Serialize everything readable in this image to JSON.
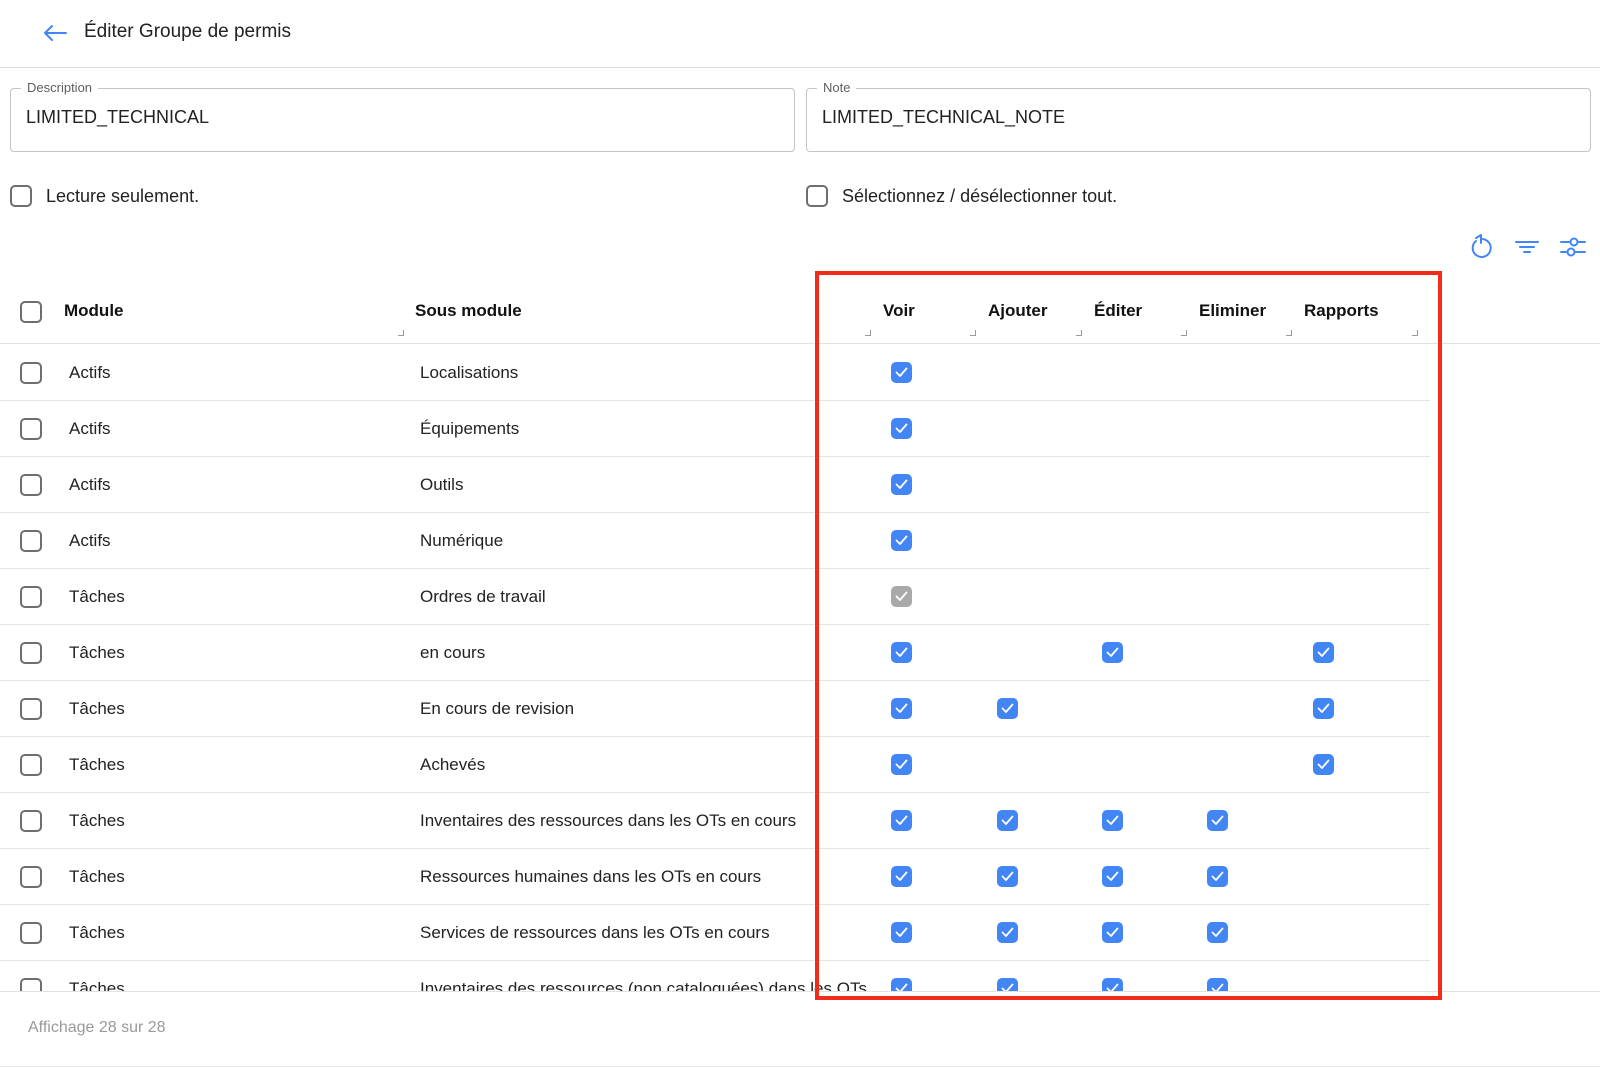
{
  "header": {
    "title": "Éditer Groupe de permis"
  },
  "form": {
    "description": {
      "label": "Description",
      "value": "LIMITED_TECHNICAL"
    },
    "note": {
      "label": "Note",
      "value": "LIMITED_TECHNICAL_NOTE"
    },
    "read_only_label": "Lecture seulement.",
    "select_all_label": "Sélectionnez / désélectionner tout."
  },
  "toolbar": {
    "icons": [
      "refresh-icon",
      "filter-icon",
      "column-settings-icon"
    ]
  },
  "table": {
    "columns": {
      "module": "Module",
      "submodule": "Sous module",
      "view": "Voir",
      "add": "Ajouter",
      "edit": "Éditer",
      "delete": "Eliminer",
      "reports": "Rapports"
    },
    "rows": [
      {
        "module": "Actifs",
        "submodule": "Localisations",
        "view": "on",
        "add": "off",
        "edit": "off",
        "delete": "off",
        "reports": "off"
      },
      {
        "module": "Actifs",
        "submodule": "Équipements",
        "view": "on",
        "add": "off",
        "edit": "off",
        "delete": "off",
        "reports": "off"
      },
      {
        "module": "Actifs",
        "submodule": "Outils",
        "view": "on",
        "add": "off",
        "edit": "off",
        "delete": "off",
        "reports": "off"
      },
      {
        "module": "Actifs",
        "submodule": "Numérique",
        "view": "on",
        "add": "off",
        "edit": "off",
        "delete": "off",
        "reports": "off"
      },
      {
        "module": "Tâches",
        "submodule": "Ordres de travail",
        "view": "disabled",
        "add": "off",
        "edit": "off",
        "delete": "off",
        "reports": "off"
      },
      {
        "module": "Tâches",
        "submodule": "en cours",
        "view": "on",
        "add": "off",
        "edit": "on",
        "delete": "off",
        "reports": "on"
      },
      {
        "module": "Tâches",
        "submodule": "En cours de revision",
        "view": "on",
        "add": "on",
        "edit": "off",
        "delete": "off",
        "reports": "on"
      },
      {
        "module": "Tâches",
        "submodule": "Achevés",
        "view": "on",
        "add": "off",
        "edit": "off",
        "delete": "off",
        "reports": "on"
      },
      {
        "module": "Tâches",
        "submodule": "Inventaires des ressources dans les OTs en cours",
        "view": "on",
        "add": "on",
        "edit": "on",
        "delete": "on",
        "reports": "off"
      },
      {
        "module": "Tâches",
        "submodule": "Ressources humaines dans les OTs en cours",
        "view": "on",
        "add": "on",
        "edit": "on",
        "delete": "on",
        "reports": "off"
      },
      {
        "module": "Tâches",
        "submodule": "Services de ressources dans les OTs en cours",
        "view": "on",
        "add": "on",
        "edit": "on",
        "delete": "on",
        "reports": "off"
      },
      {
        "module": "Tâches",
        "submodule": "Inventaires des ressources (non cataloguées) dans les OTs",
        "view": "on",
        "add": "on",
        "edit": "on",
        "delete": "on",
        "reports": "off"
      }
    ]
  },
  "footer": {
    "count_text": "Affichage 28 sur 28"
  },
  "colors": {
    "accent": "#4285f4",
    "disabled": "#a9a9a9",
    "highlight": "#f22b1b"
  }
}
